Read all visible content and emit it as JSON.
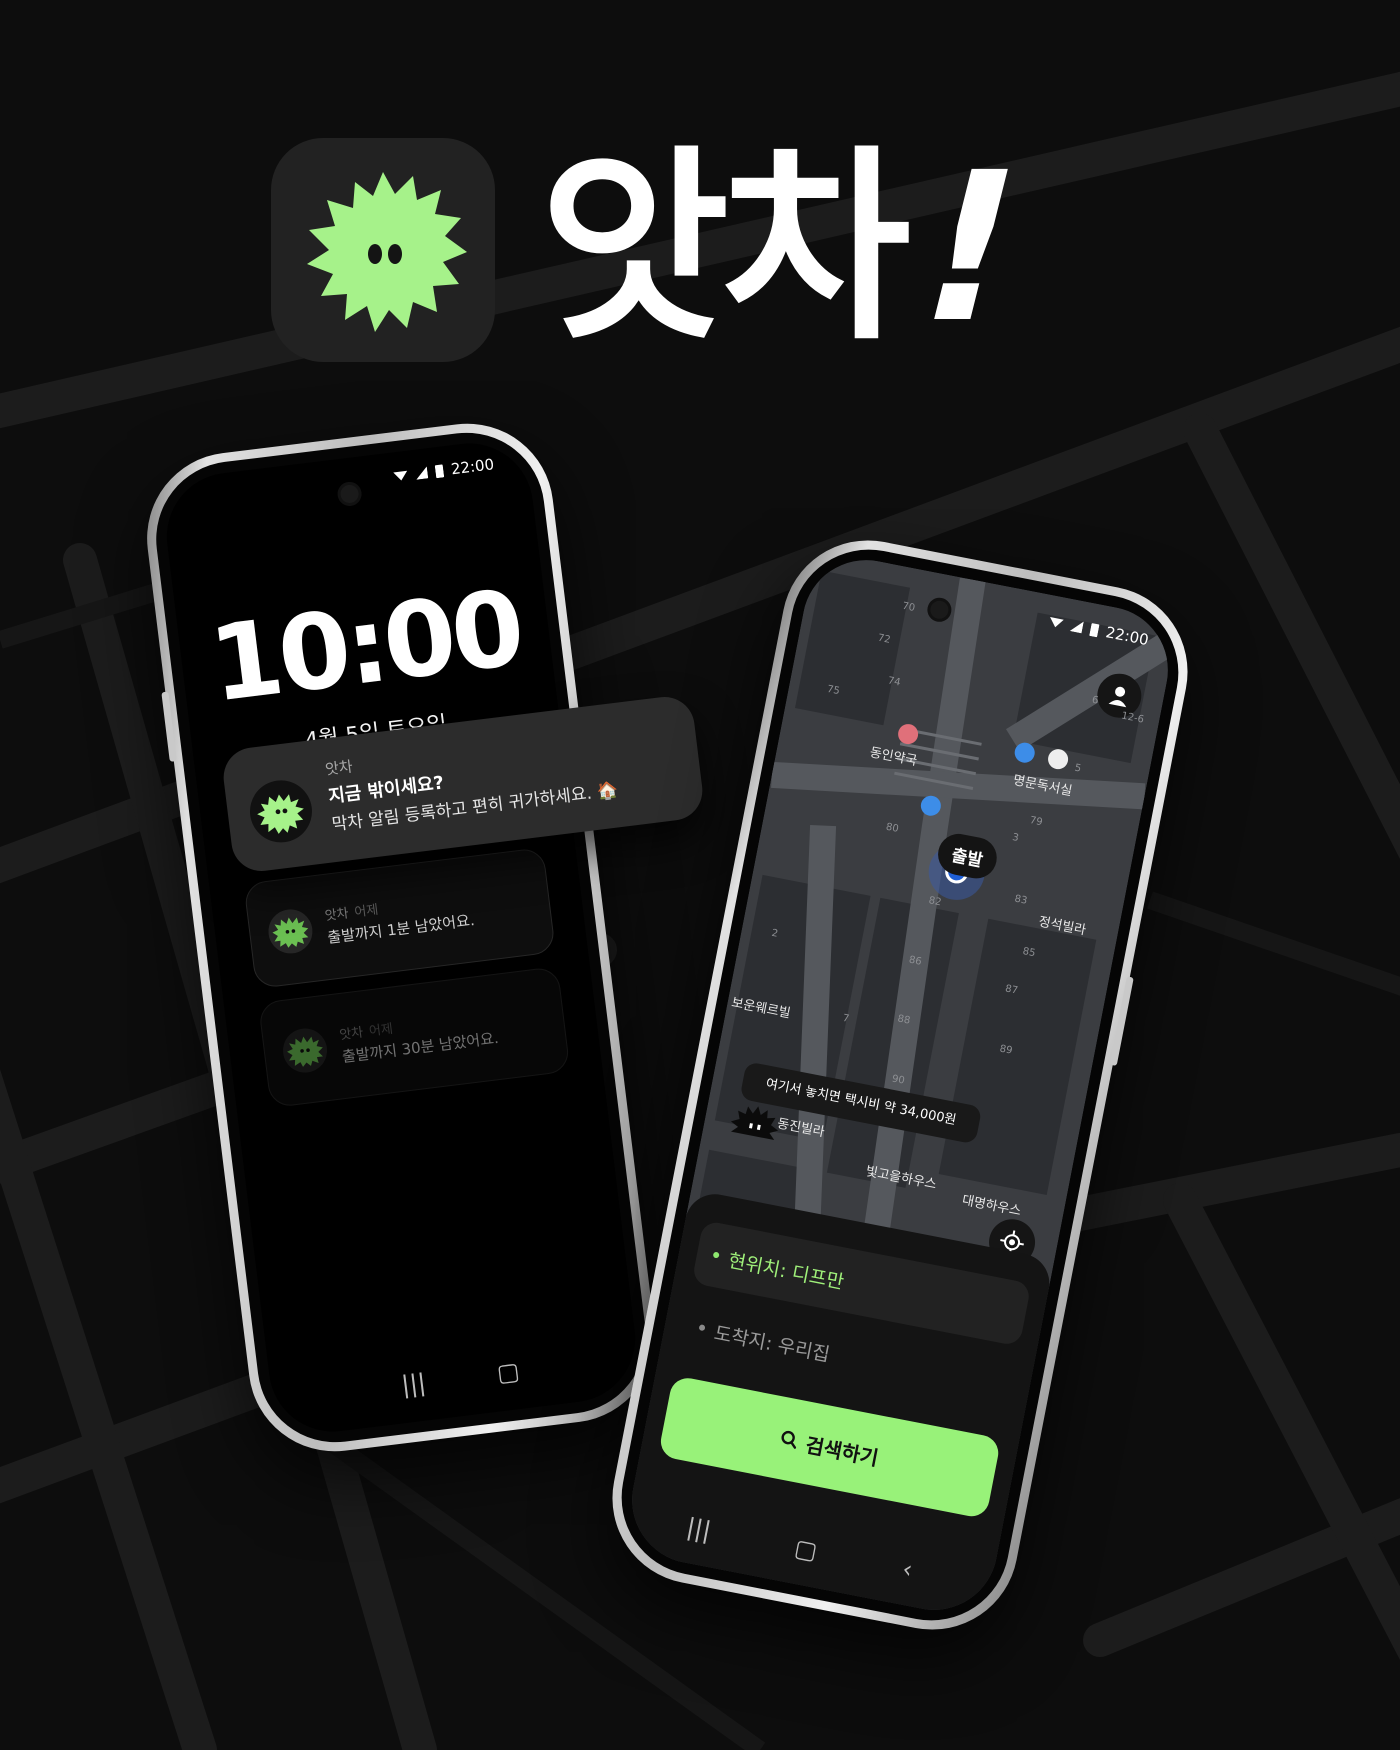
{
  "header": {
    "app_name": "앗차",
    "exclamation": "!"
  },
  "colors": {
    "background": "#0d0d0d",
    "accent_green": "#98f279",
    "mascot_green": "#a6f28a",
    "map_dark": "#3b3d41"
  },
  "phone_left": {
    "status_time": "22:00",
    "lockscreen_time": "10:00",
    "lockscreen_date": "4월 5일 토요일",
    "notifications": [
      {
        "app": "앗차",
        "when": "어제",
        "text": "출발까지 1분 남았어요."
      },
      {
        "app": "앗차",
        "when": "어제",
        "text": "출발까지 30분 남았어요."
      }
    ],
    "nav_icons": [
      "recent-apps-icon",
      "home-icon"
    ]
  },
  "float_notification": {
    "app": "앗차",
    "title": "지금 밖이세요?",
    "body": "막차 알림 등록하고 편히 귀가하세요. 🏠"
  },
  "phone_right": {
    "status_time": "22:00",
    "map": {
      "pois": [
        "동인약국",
        "명문독서실",
        "정석빌라",
        "동진빌라",
        "빛고을하우스",
        "대명하우스",
        "보운웨르빌"
      ],
      "numbers": [
        "70",
        "72",
        "74",
        "75",
        "79",
        "80",
        "82",
        "83",
        "85",
        "86",
        "87",
        "88",
        "89",
        "90",
        "12-6",
        "5",
        "3",
        "2",
        "6",
        "7"
      ],
      "start_label": "출발",
      "taxi_message": "여기서 놓치면 택시비 약 34,000원"
    },
    "sheet": {
      "current": "현위치: 디프만",
      "destination": "도착지: 우리집",
      "search_button": "검색하기"
    },
    "nav_icons": [
      "recent-apps-icon",
      "home-icon",
      "back-icon"
    ]
  }
}
